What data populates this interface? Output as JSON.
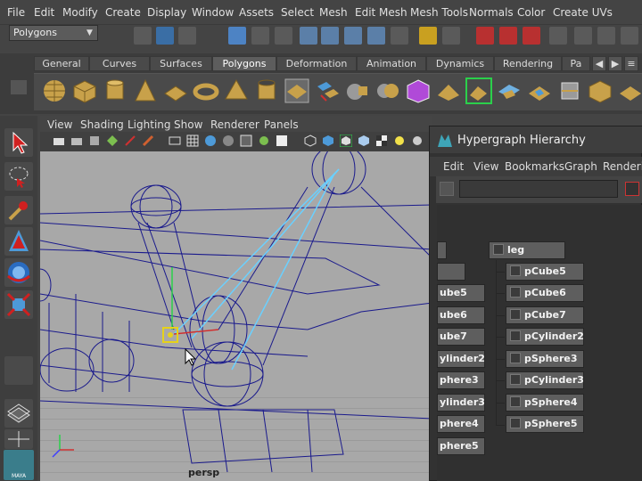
{
  "menubar": [
    "File",
    "Edit",
    "Modify",
    "Create",
    "Display",
    "Window",
    "Assets",
    "Select",
    "Mesh",
    "Edit Mesh",
    "Mesh Tools",
    "Normals",
    "Color",
    "Create UVs"
  ],
  "status": {
    "mode": "Polygons"
  },
  "shelf": {
    "tabs": [
      "General",
      "Curves",
      "Surfaces",
      "Polygons",
      "Deformation",
      "Animation",
      "Dynamics",
      "Rendering",
      "Pa"
    ],
    "active_tab": "Polygons"
  },
  "viewport": {
    "menu": [
      "View",
      "Shading",
      "Lighting",
      "Show",
      "Renderer",
      "Panels"
    ],
    "camera_label": "persp"
  },
  "hypergraph": {
    "title": "Hypergraph Hierarchy",
    "menu": [
      "Edit",
      "View",
      "Bookmarks",
      "Graph",
      "Renderin"
    ],
    "root": "leg",
    "children": [
      "pCube5",
      "pCube6",
      "pCube7",
      "pCylinder2",
      "pSphere3",
      "pCylinder3",
      "pSphere4",
      "pSphere5"
    ],
    "left_column": [
      "",
      "",
      "ube5",
      "ube6",
      "ube7",
      "ylinder2",
      "phere3",
      "ylinder3",
      "phere4",
      "phere5"
    ]
  },
  "colors": {
    "wire": "#1a1a8c",
    "selected": "#6ad0ff",
    "accent": "#2bd04b"
  },
  "logo": "MAYA"
}
